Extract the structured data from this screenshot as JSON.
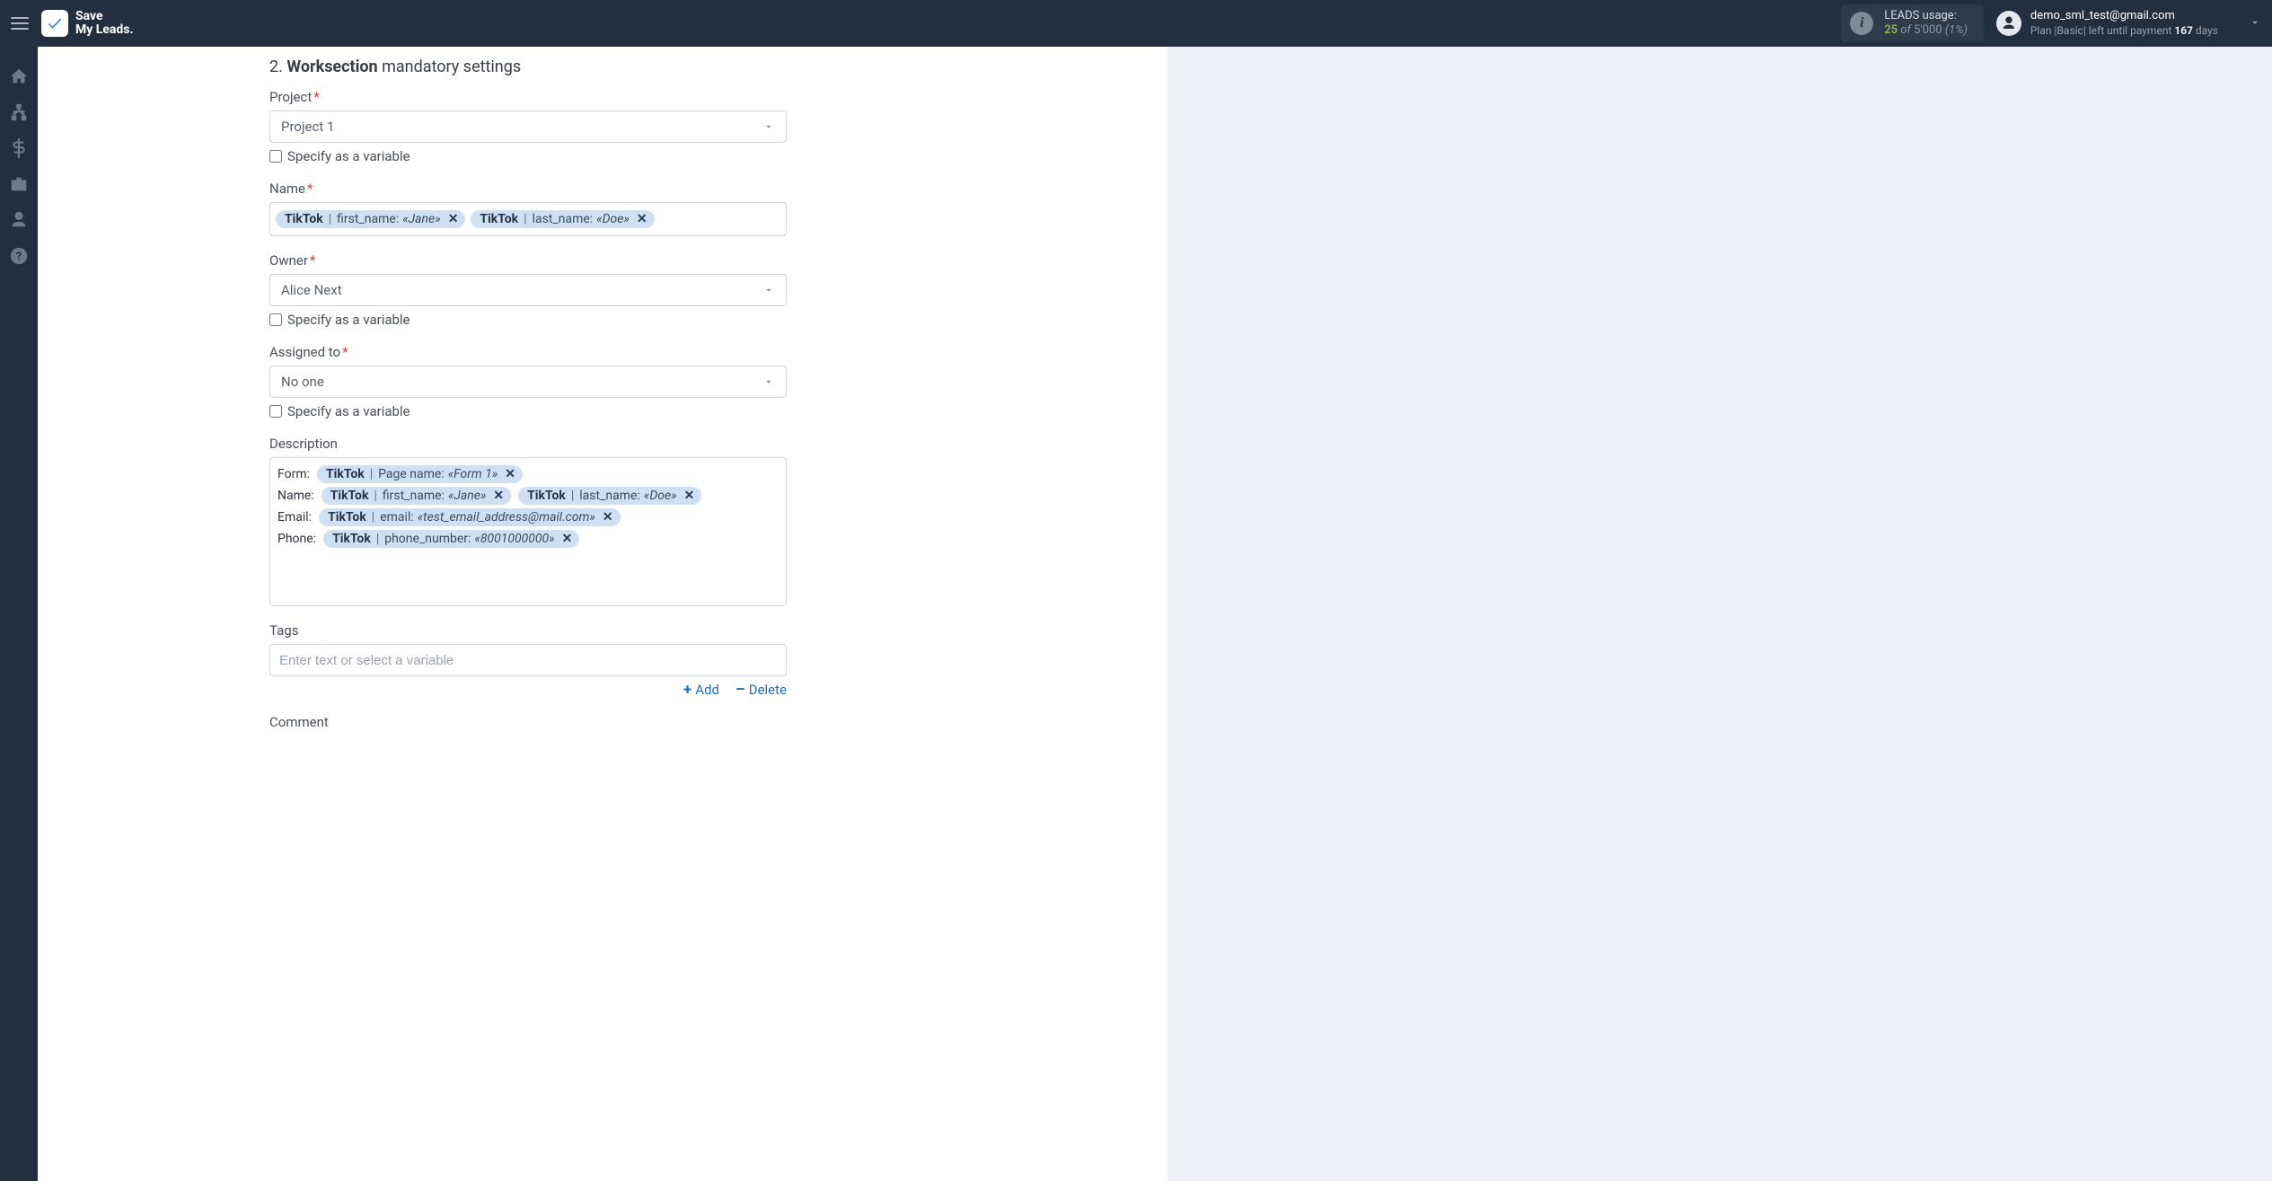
{
  "brand": {
    "line1": "Save",
    "line2": "My Leads"
  },
  "usage": {
    "label": "LEADS usage:",
    "used": "25",
    "of": "of",
    "total": "5'000",
    "pct": "(1%)"
  },
  "user": {
    "email": "demo_sml_test@gmail.com",
    "plan_prefix": "Plan |Basic| left until payment ",
    "plan_days_num": "167",
    "plan_days_suffix": " days"
  },
  "sidebar_icons": [
    "home",
    "sitemap",
    "dollar",
    "briefcase",
    "user",
    "help"
  ],
  "section": {
    "num": "2.",
    "strong": "Worksection",
    "rest": "mandatory settings"
  },
  "labels": {
    "project": "Project",
    "name": "Name",
    "owner": "Owner",
    "assigned": "Assigned to",
    "description": "Description",
    "tags": "Tags",
    "comment": "Comment",
    "specify_var": "Specify as a variable",
    "tags_placeholder": "Enter text or select a variable",
    "add": "Add",
    "delete": "Delete"
  },
  "values": {
    "project": "Project 1",
    "owner": "Alice Next",
    "assigned": "No one"
  },
  "name_chips": [
    {
      "src": "TikTok",
      "key": "first_name:",
      "val": "«Jane»"
    },
    {
      "src": "TikTok",
      "key": "last_name:",
      "val": "«Doe»"
    }
  ],
  "desc_rows": [
    {
      "label": "Form:",
      "chips": [
        {
          "src": "TikTok",
          "key": "Page name:",
          "val": "«Form 1»"
        }
      ]
    },
    {
      "label": "Name:",
      "chips": [
        {
          "src": "TikTok",
          "key": "first_name:",
          "val": "«Jane»"
        },
        {
          "src": "TikTok",
          "key": "last_name:",
          "val": "«Doe»"
        }
      ]
    },
    {
      "label": "Email:",
      "chips": [
        {
          "src": "TikTok",
          "key": "email:",
          "val": "«test_email_address@mail.com»"
        }
      ]
    },
    {
      "label": "Phone:",
      "chips": [
        {
          "src": "TikTok",
          "key": "phone_number:",
          "val": "«8001000000»"
        }
      ]
    }
  ]
}
